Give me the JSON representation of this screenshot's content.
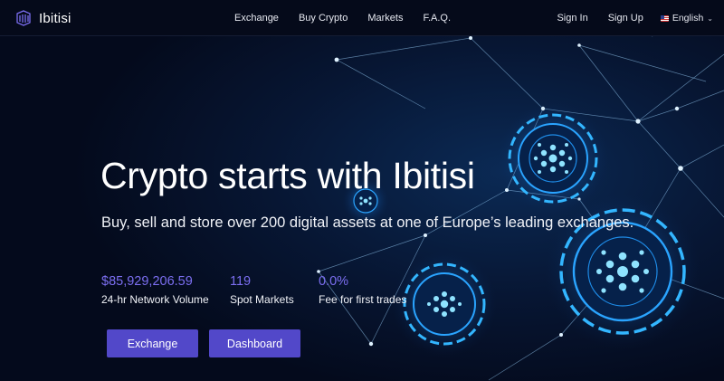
{
  "brand": {
    "name": "Ibitisi"
  },
  "nav": {
    "links": [
      "Exchange",
      "Buy Crypto",
      "Markets",
      "F.A.Q."
    ],
    "sign_in": "Sign In",
    "sign_up": "Sign Up",
    "language": "English"
  },
  "hero": {
    "title": "Crypto starts with Ibitisi",
    "subtitle": "Buy, sell and store over 200 digital assets at one of Europe’s leading exchanges.",
    "stats": [
      {
        "value": "$85,929,206.59",
        "label": "24-hr Network Volume"
      },
      {
        "value": "119",
        "label": "Spot Markets"
      },
      {
        "value": "0.0%",
        "label": "Fee for first trades"
      }
    ],
    "buttons": {
      "exchange": "Exchange",
      "dashboard": "Dashboard"
    }
  },
  "colors": {
    "accent": "#5248c9",
    "stat_value": "#7b6ef0",
    "background": "#040a1c",
    "glow": "#1fa8ff"
  },
  "icons": {
    "logo": "layered-cube-logo-icon",
    "flag": "us-flag-icon",
    "language_chevron": "chevron-down-icon"
  }
}
